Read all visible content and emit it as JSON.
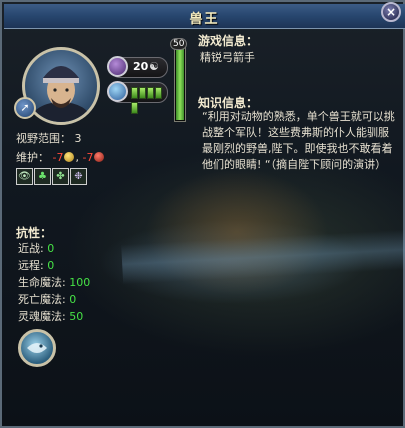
{
  "window": {
    "title": "兽王",
    "close_symbol": "×"
  },
  "unit": {
    "attack_value": "20",
    "level_badge": "50",
    "xp_fraction": 1.0,
    "health_pips_filled": 5,
    "health_pips_total": 5
  },
  "stats": {
    "vision_label": "视野范围：",
    "vision_value": "3",
    "upkeep_label": "维护：",
    "upkeep_gold": "-7",
    "upkeep_food": "-7"
  },
  "abilities_icons": [
    "eye-icon",
    "tree-icon",
    "paw-icon",
    "mist-icon"
  ],
  "resistances": {
    "heading": "抗性：",
    "rows": [
      {
        "label": "近战:",
        "value": "0"
      },
      {
        "label": "远程:",
        "value": "0"
      },
      {
        "label": "生命魔法:",
        "value": "100"
      },
      {
        "label": "死亡魔法:",
        "value": "0"
      },
      {
        "label": "灵魂魔法:",
        "value": "50"
      }
    ]
  },
  "game_info": {
    "heading": "游戏信息：",
    "text": "精锐弓箭手"
  },
  "lore_info": {
    "heading": "知识信息：",
    "text": "“利用对动物的熟悉，单个兽王就可以挑战整个军队！这些费弗斯的仆人能驯服最刚烈的野兽,陛下。即使我也不敢看着他们的眼睛! “（摘自陛下顾问的演讲）"
  },
  "colors": {
    "title_bar": "#27466e",
    "positive": "#46e246",
    "negative": "#ff4a3a"
  }
}
